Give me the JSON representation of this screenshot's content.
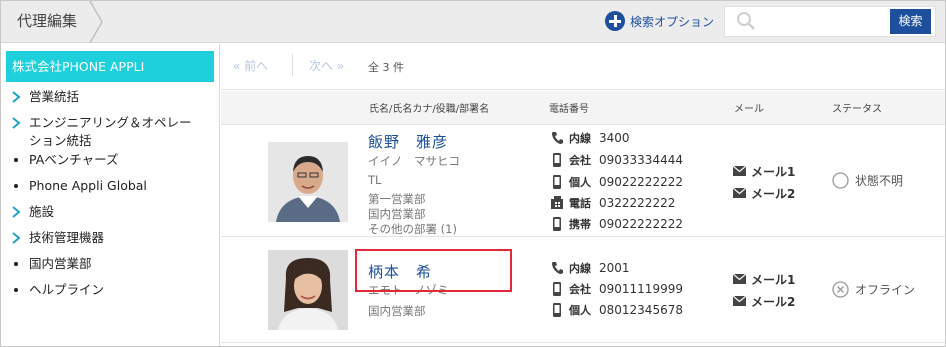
{
  "header": {
    "breadcrumb": "代理編集",
    "search_options_label": "検索オプション",
    "search_placeholder": "",
    "search_button": "検索"
  },
  "sidebar": {
    "selected": "株式会社PHONE APPLI",
    "items": [
      {
        "label": "営業統括",
        "type": "expandable"
      },
      {
        "label": "エンジニアリング＆オペレー",
        "label2": "ション統括",
        "type": "expandable"
      },
      {
        "label": "PAベンチャーズ",
        "type": "leaf"
      },
      {
        "label": "Phone Appli Global",
        "type": "leaf"
      },
      {
        "label": "施設",
        "type": "expandable"
      },
      {
        "label": "技術管理機器",
        "type": "expandable"
      },
      {
        "label": "国内営業部",
        "type": "leaf"
      },
      {
        "label": "ヘルプライン",
        "type": "leaf"
      }
    ]
  },
  "pager": {
    "prev": "前へ",
    "next": "次へ",
    "total": "全 3 件"
  },
  "columns": {
    "name": "氏名/氏名カナ/役職/部署名",
    "phone": "電話番号",
    "mail": "メール",
    "status": "ステータス"
  },
  "contacts": [
    {
      "name": "飯野　雅彦",
      "kana": "イイノ　マサヒコ",
      "title": "TL",
      "dept1": "第一営業部",
      "dept2": "国内営業部",
      "dept3": "その他の部署 (1)",
      "phones": [
        {
          "type": "内線",
          "number": "3400",
          "icon": "phone-icon"
        },
        {
          "type": "会社",
          "number": "09033334444",
          "icon": "mobile-icon"
        },
        {
          "type": "個人",
          "number": "09022222222",
          "icon": "mobile-icon"
        },
        {
          "type": "電話",
          "number": "0322222222",
          "icon": "fax-icon"
        },
        {
          "type": "携帯",
          "number": "09022222222",
          "icon": "mobile-icon"
        }
      ],
      "mails": [
        "メール1",
        "メール2"
      ],
      "status": "状態不明"
    },
    {
      "name": "柄本　希",
      "kana": "エモト　ノゾミ",
      "dept1": "国内営業部",
      "phones": [
        {
          "type": "内線",
          "number": "2001",
          "icon": "phone-icon"
        },
        {
          "type": "会社",
          "number": "09011119999",
          "icon": "mobile-icon"
        },
        {
          "type": "個人",
          "number": "08012345678",
          "icon": "mobile-icon"
        }
      ],
      "mails": [
        "メール1",
        "メール2"
      ],
      "status": "オフライン"
    }
  ],
  "colors": {
    "accent": "#1d4f9c",
    "sidebar_selected": "#1ecfdc",
    "highlight": "#e02a3a"
  }
}
